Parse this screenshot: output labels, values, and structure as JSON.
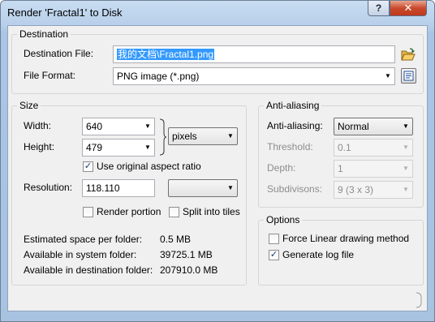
{
  "window": {
    "title": "Render 'Fractal1' to Disk",
    "help_label": "?",
    "close_label": "✕"
  },
  "destination": {
    "group_title": "Destination",
    "file_label": "Destination File:",
    "file_value": "我的文档\\Fractal1.png",
    "browse_icon": "folder-open-icon",
    "format_label": "File Format:",
    "format_value": "PNG image (*.png)",
    "format_options_icon": "options-icon"
  },
  "size": {
    "group_title": "Size",
    "width_label": "Width:",
    "width_value": "640",
    "height_label": "Height:",
    "height_value": "479",
    "unit_value": "pixels",
    "aspect_label": "Use original aspect ratio",
    "aspect_checked": true,
    "resolution_label": "Resolution:",
    "resolution_value": "118.110",
    "resolution_unit_value": "",
    "render_portion_label": "Render portion",
    "render_portion_checked": false,
    "split_tiles_label": "Split into tiles",
    "split_tiles_checked": false,
    "est_space_label": "Estimated space per folder:",
    "est_space_value": "0.5 MB",
    "avail_system_label": "Available in system folder:",
    "avail_system_value": "39725.1 MB",
    "avail_dest_label": "Available in destination folder:",
    "avail_dest_value": "207910.0 MB"
  },
  "antialiasing": {
    "group_title": "Anti-aliasing",
    "mode_label": "Anti-aliasing:",
    "mode_value": "Normal",
    "threshold_label": "Threshold:",
    "threshold_value": "0.1",
    "depth_label": "Depth:",
    "depth_value": "1",
    "subdivisions_label": "Subdivisons:",
    "subdivisions_value": "9 (3 x 3)"
  },
  "options": {
    "group_title": "Options",
    "force_linear_label": "Force Linear drawing method",
    "force_linear_checked": false,
    "gen_log_label": "Generate log file",
    "gen_log_checked": true
  }
}
